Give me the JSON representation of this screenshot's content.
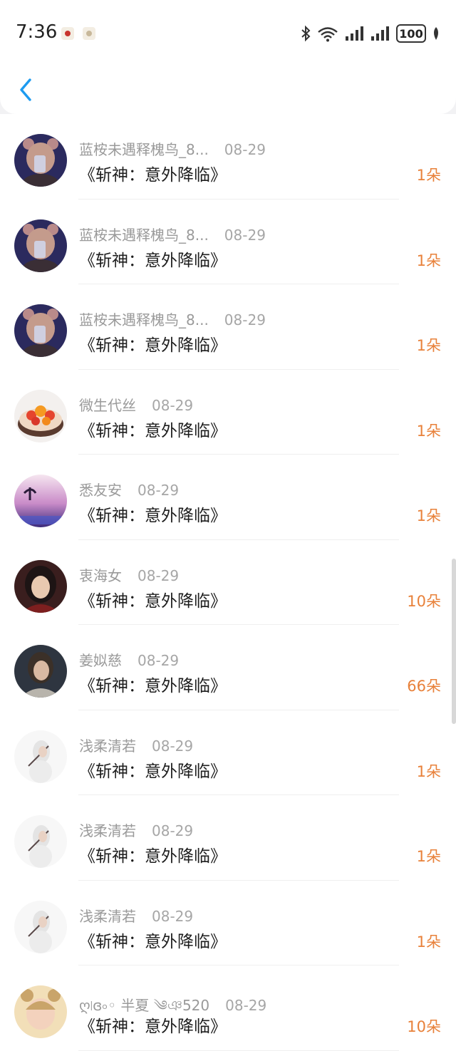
{
  "status_bar": {
    "time": "7:36",
    "battery": "100",
    "icons": [
      "app-notification-icon",
      "app-notification-icon",
      "bluetooth-icon",
      "wifi-icon",
      "signal-icon",
      "signal-icon",
      "battery-icon",
      "leaf-icon"
    ]
  },
  "header": {
    "back_icon": "chevron-left-icon"
  },
  "accent_color": "#1d9bf0",
  "count_color": "#e8813a",
  "items": [
    {
      "name": "蓝桉未遇释槐鸟_8...",
      "date": "08-29",
      "title": "《斩神：意外降临》",
      "count": "1朵"
    },
    {
      "name": "蓝桉未遇释槐鸟_8...",
      "date": "08-29",
      "title": "《斩神：意外降临》",
      "count": "1朵"
    },
    {
      "name": "蓝桉未遇释槐鸟_8...",
      "date": "08-29",
      "title": "《斩神：意外降临》",
      "count": "1朵"
    },
    {
      "name": "微生代丝",
      "date": "08-29",
      "title": "《斩神：意外降临》",
      "count": "1朵"
    },
    {
      "name": "悉友安",
      "date": "08-29",
      "title": "《斩神：意外降临》",
      "count": "1朵"
    },
    {
      "name": "衷海女",
      "date": "08-29",
      "title": "《斩神：意外降临》",
      "count": "10朵"
    },
    {
      "name": "姜姒慈",
      "date": "08-29",
      "title": "《斩神：意外降临》",
      "count": "66朵"
    },
    {
      "name": "浅柔清若",
      "date": "08-29",
      "title": "《斩神：意外降临》",
      "count": "1朵"
    },
    {
      "name": "浅柔清若",
      "date": "08-29",
      "title": "《斩神：意外降临》",
      "count": "1朵"
    },
    {
      "name": "浅柔清若",
      "date": "08-29",
      "title": "《斩神：意外降临》",
      "count": "1朵"
    },
    {
      "name": "ღ৷ɞ৹◦ 半夏 ༄ঞ520",
      "date": "08-29",
      "title": "《斩神：意外降临》",
      "count": "10朵"
    }
  ]
}
